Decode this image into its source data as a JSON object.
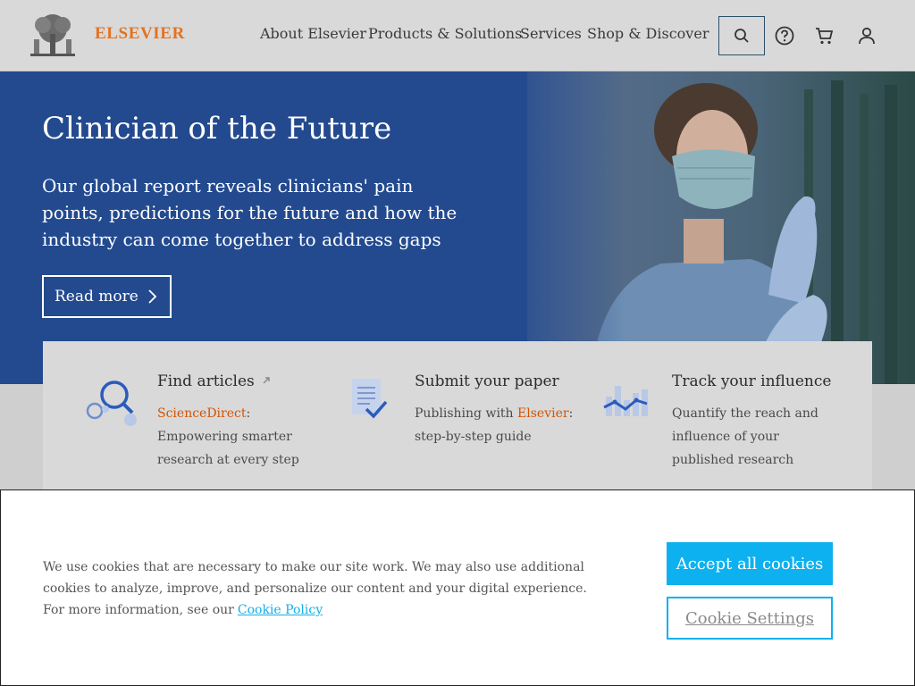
{
  "brand": {
    "name": "ELSEVIER",
    "color": "#e3731f"
  },
  "nav": {
    "items": [
      {
        "label": "About Elsevier"
      },
      {
        "label": "Products & Solutions"
      },
      {
        "label": "Services"
      },
      {
        "label": "Shop & Discover"
      }
    ],
    "icons": [
      "search-icon",
      "help-icon",
      "cart-icon",
      "user-icon"
    ]
  },
  "hero": {
    "title": "Clinician of the Future",
    "text": "Our global report reveals clinicians' pain points, predictions for the future and how the industry can come together to address gaps",
    "cta_label": "Read more",
    "bg_color": "#234a8f"
  },
  "features": [
    {
      "title": "Find articles",
      "external_icon": "external-link-icon",
      "link": "ScienceDirect",
      "link_suffix": ":",
      "desc": "Empowering smarter research at every step",
      "icon": "magnifier-icon"
    },
    {
      "title": "Submit your paper",
      "desc_prefix": "Publishing with",
      "link": "Elsevier",
      "link_suffix": ":",
      "desc": "step-by-step guide",
      "icon": "document-check-icon"
    },
    {
      "title": "Track your influence",
      "desc": "Quantify the reach and influence of your published research",
      "icon": "chart-icon"
    }
  ],
  "cookie": {
    "text": "We use cookies that are necessary to make our site work. We may also use additional cookies to analyze, improve, and personalize our content and your digital experience. For more information, see our",
    "link_label": "Cookie Policy",
    "accept_label": "Accept all cookies",
    "settings_label": "Cookie Settings",
    "accent": "#0eb1ef"
  }
}
